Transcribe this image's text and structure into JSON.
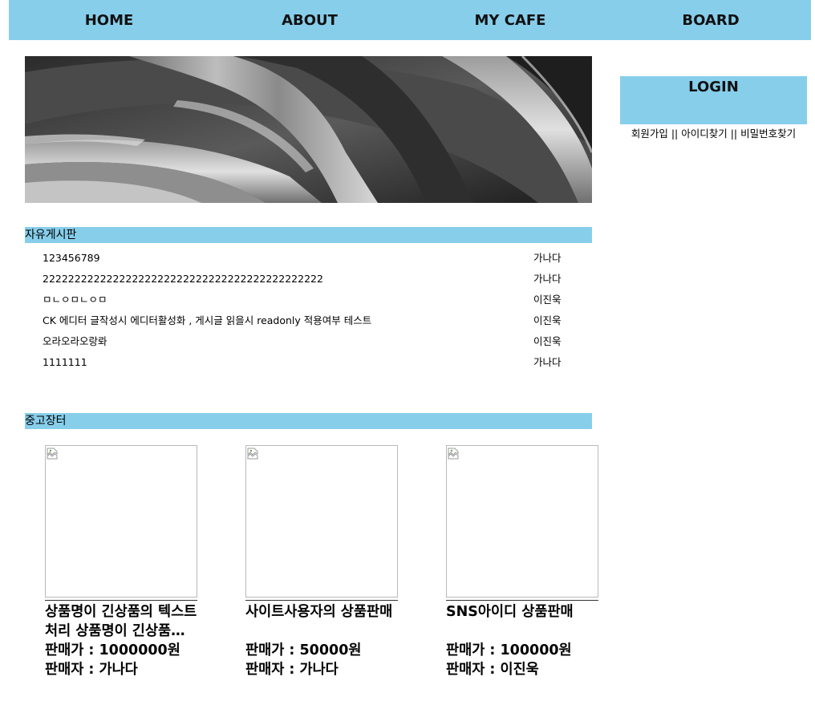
{
  "theme": {
    "accent": "#87CEEB"
  },
  "nav": {
    "items": [
      {
        "label": "HOME"
      },
      {
        "label": "ABOUT"
      },
      {
        "label": "MY CAFE"
      },
      {
        "label": "BOARD"
      }
    ]
  },
  "login": {
    "title": "LOGIN",
    "signup": "회원가입",
    "find_id": "아이디찾기",
    "find_pw": "비밀번호찾기",
    "separator": " || "
  },
  "free_board": {
    "title": "자유게시판",
    "posts": [
      {
        "title": "123456789",
        "author": "가나다"
      },
      {
        "title": "22222222222222222222222222222222222222222222",
        "author": "가나다"
      },
      {
        "title": "ㅁㄴㅇㅁㄴㅇㅁ",
        "author": "이진욱"
      },
      {
        "title": "CK 에디터 글작성시 에디터활성화 , 게시글 읽을시 readonly 적용여부 테스트",
        "author": "이진욱"
      },
      {
        "title": "오라오라오랑롸",
        "author": "이진욱"
      },
      {
        "title": "1111111",
        "author": "가나다"
      }
    ]
  },
  "market": {
    "title": "중고장터",
    "products": [
      {
        "name": "상품명이 긴상품의 텍스트 처리 상품명이 긴상품의 텍스트 처리",
        "price": "판매가 : 1000000원",
        "seller": "판매자 : 가나다"
      },
      {
        "name": "사이트사용자의 상품판매",
        "price": "판매가 : 50000원",
        "seller": "판매자 : 가나다"
      },
      {
        "name": "SNS아이디 상품판매",
        "price": "판매가 : 100000원",
        "seller": "판매자 : 이진욱"
      }
    ]
  }
}
